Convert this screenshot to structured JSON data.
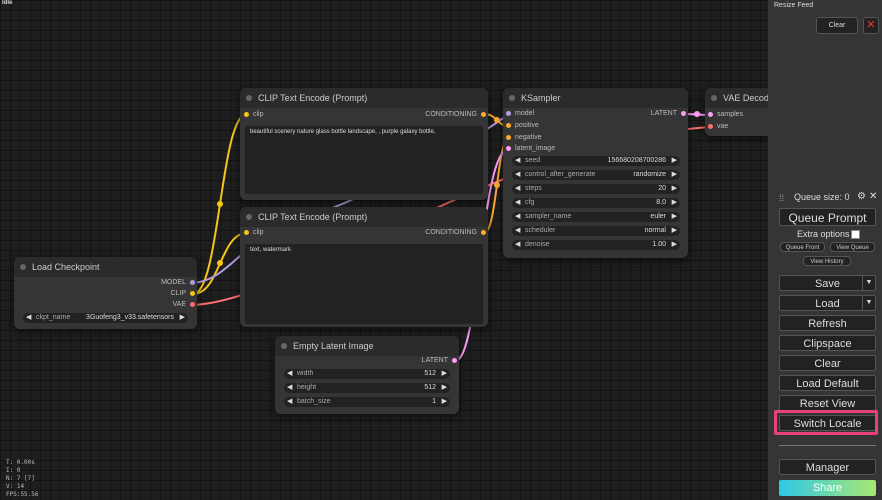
{
  "top_label": "Idle",
  "stats": [
    "T: 0.00s",
    "I: 0",
    "N: 7 [7]",
    "V: 14",
    "FPS:55.56"
  ],
  "nodes": {
    "clip1": {
      "title": "CLIP Text Encode (Prompt)",
      "input": "clip",
      "output": "CONDITIONING",
      "text": "beautiful scenery nature glass bottle landscape, , purple galaxy bottle,"
    },
    "clip2": {
      "title": "CLIP Text Encode (Prompt)",
      "input": "clip",
      "output": "CONDITIONING",
      "text": "text, watermark"
    },
    "ksampler": {
      "title": "KSampler",
      "inputs": [
        "model",
        "positive",
        "negative",
        "latent_image"
      ],
      "output": "LATENT",
      "widgets": [
        {
          "label": "seed",
          "value": "156680208700286"
        },
        {
          "label": "control_after_generate",
          "value": "randomize"
        },
        {
          "label": "steps",
          "value": "20"
        },
        {
          "label": "cfg",
          "value": "8.0"
        },
        {
          "label": "sampler_name",
          "value": "euler"
        },
        {
          "label": "scheduler",
          "value": "normal"
        },
        {
          "label": "denoise",
          "value": "1.00"
        }
      ]
    },
    "vae": {
      "title": "VAE Decode",
      "inputs": [
        "samples",
        "vae"
      ]
    },
    "checkpoint": {
      "title": "Load Checkpoint",
      "outputs": [
        "MODEL",
        "CLIP",
        "VAE"
      ],
      "widget": {
        "label": "ckpt_name",
        "value": "3Guofeng3_v33.safetensors"
      }
    },
    "latent": {
      "title": "Empty Latent Image",
      "output": "LATENT",
      "widgets": [
        {
          "label": "width",
          "value": "512"
        },
        {
          "label": "height",
          "value": "512"
        },
        {
          "label": "batch_size",
          "value": "1"
        }
      ]
    }
  },
  "panel": {
    "resize_label": "Resize Feed",
    "clear": "Clear",
    "close": "✕",
    "drag": "⁞⁞",
    "queue_size": "Queue size: 0",
    "gear": "⚙",
    "x": "✕",
    "queue_prompt": "Queue Prompt",
    "extra_options": "Extra options",
    "queue_front": "Queue Front",
    "view_queue": "View Queue",
    "view_history": "View History",
    "save": "Save",
    "load": "Load",
    "refresh": "Refresh",
    "clipspace": "Clipspace",
    "clear_btn": "Clear",
    "load_default": "Load Default",
    "reset_view": "Reset View",
    "switch_locale": "Switch Locale",
    "manager": "Manager",
    "share": "Share"
  },
  "colors": {
    "highlight": "#e8417a",
    "clip_link": "#f5c518",
    "model_link": "#b39ddb",
    "vae_link": "#ff6e6e",
    "latent_link": "#ff9cf9",
    "conditioning_link": "#ffa931"
  }
}
